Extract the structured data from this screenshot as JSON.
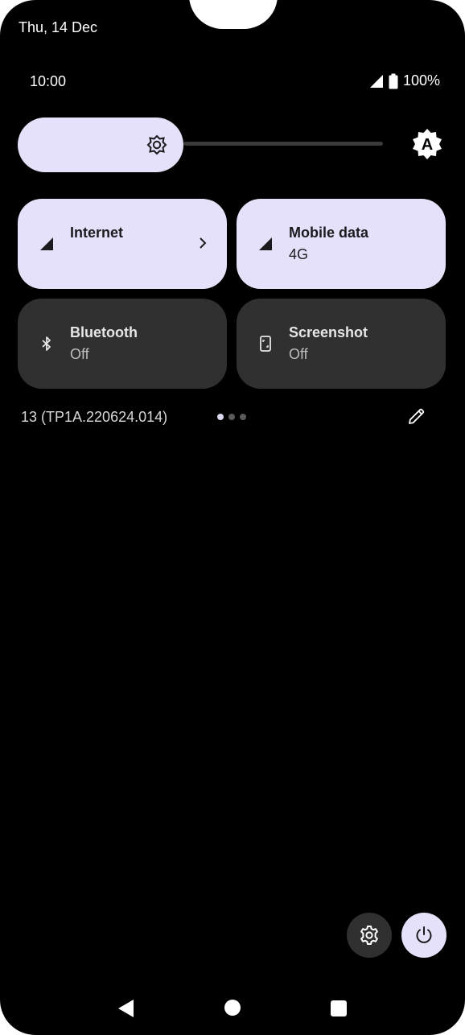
{
  "header": {
    "date": "Thu, 14 Dec"
  },
  "status_bar": {
    "time": "10:00",
    "battery": "100%"
  },
  "brightness": {
    "level": 0.34,
    "auto_label": "A"
  },
  "tiles": [
    {
      "title": "Internet",
      "subtitle": "",
      "state": "on",
      "icon": "signal-icon",
      "has_chevron": true
    },
    {
      "title": "Mobile data",
      "subtitle": "4G",
      "state": "on",
      "icon": "signal-icon"
    },
    {
      "title": "Bluetooth",
      "subtitle": "Off",
      "state": "off",
      "icon": "bluetooth-icon"
    },
    {
      "title": "Screenshot",
      "subtitle": "Off",
      "state": "off",
      "icon": "screenshot-icon"
    }
  ],
  "footer": {
    "build": "13 (TP1A.220624.014)",
    "page_count": 3,
    "current_page": 1
  },
  "colors": {
    "background": "#000000",
    "tile_on": "#e5e1fa",
    "tile_off": "#303030"
  }
}
